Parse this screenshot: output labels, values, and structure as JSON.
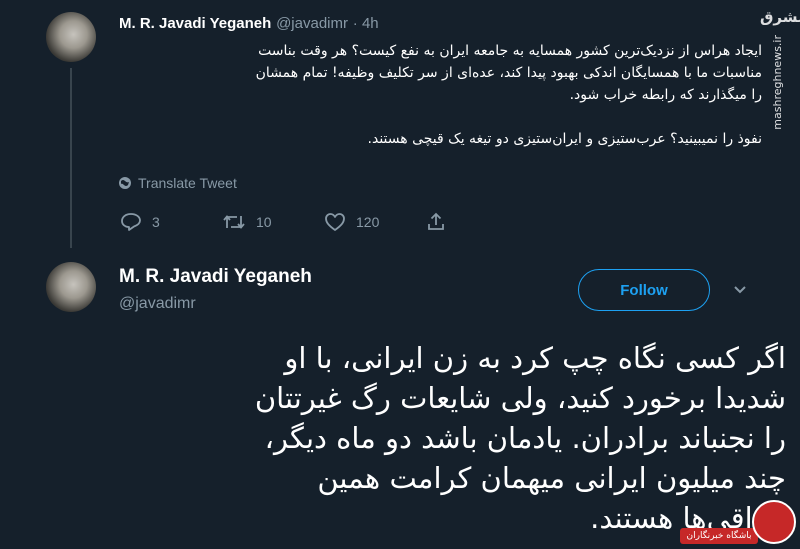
{
  "tweet1": {
    "name": "M. R. Javadi Yeganeh",
    "handle": "@javadimr",
    "time": "· 4h",
    "text_line1": "ایجاد هراس از نزدیک‌ترین کشور همسایه به جامعه ایران به نفع کیست؟ هر وقت بناست",
    "text_line2": "مناسبات ما با همسایگان اندکی بهبود پیدا کند، عده‌ای از سر تکلیف وظیفه! تمام همشان",
    "text_line3": "را میگذارند که رابطه خراب شود.",
    "text_line4": "نفوذ را نمیبینید؟ عرب‌ستیزی و ایران‌ستیزی دو تیغه یک قیچی هستند.",
    "translate": "Translate Tweet",
    "replies": "3",
    "retweets": "10",
    "likes": "120"
  },
  "tweet2": {
    "name": "M. R. Javadi Yeganeh",
    "handle": "@javadimr",
    "follow_label": "Follow",
    "line1": "اگر کسی نگاه چپ کرد به زن ایرانی، با او",
    "line2": "شدیدا برخورد کنید، ولی شایعات رگ غیرتتان",
    "line3": "را نجنباند برادران. یادمان باشد دو ماه دیگر،",
    "line4": "چند میلیون ایرانی میهمان کرامت همین",
    "line5": "عراقی‌ها هستند."
  },
  "watermark": {
    "site": "mashreghnews.ir",
    "logo_text": "مشرق",
    "badge_text": "باشگاه خبرنگاران"
  },
  "colors": {
    "background": "#15202b",
    "accent": "#1da1f2",
    "muted": "#8899a6"
  }
}
